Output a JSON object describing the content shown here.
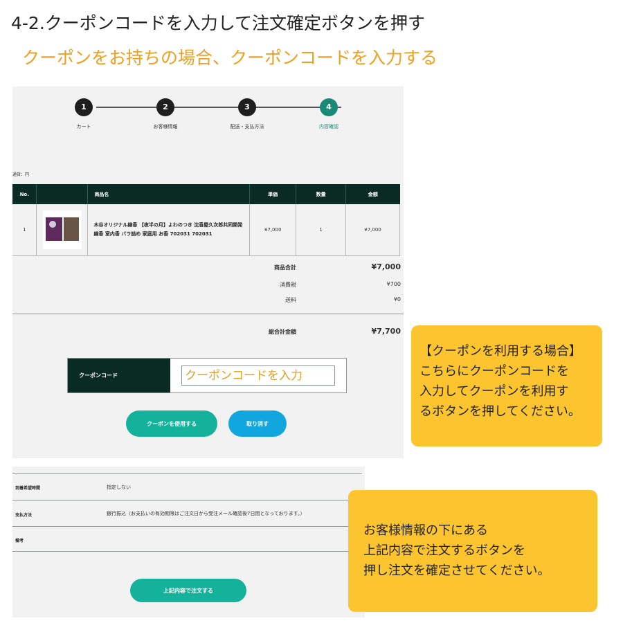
{
  "header": {
    "title": "4-2.クーポンコードを入力して注文確定ボタンを押す",
    "subtitle": "クーポンをお持ちの場合、クーポンコードを入力する"
  },
  "steps": [
    {
      "number": "1",
      "label": "カート"
    },
    {
      "number": "2",
      "label": "お客様情報"
    },
    {
      "number": "3",
      "label": "配送・支払方法"
    },
    {
      "number": "4",
      "label": "内容確認",
      "active": true
    }
  ],
  "currency_note": "通貨：円",
  "table": {
    "headers": [
      "No.",
      "",
      "商品名",
      "単価",
      "数量",
      "金額"
    ],
    "rows": [
      {
        "no": "1",
        "name": "木谷オリジナル線香 【夜半の月】よわのつき 沈香屋久次郎共同開発 線香 室内香 バラ詰め 家庭用 お香 702031 702031",
        "unit_price": "¥7,000",
        "quantity": "1",
        "amount": "¥7,000"
      }
    ]
  },
  "summary": {
    "subtotal_label": "商品合計",
    "subtotal": "¥7,000",
    "tax_label": "消費税",
    "tax": "¥700",
    "shipping_label": "送料",
    "shipping": "¥0",
    "total_label": "総合計金額",
    "total": "¥7,700"
  },
  "coupon": {
    "label": "クーポンコード",
    "placeholder": "クーポンコードを入力",
    "use_button": "クーポンを使用する",
    "cancel_button": "取り消す"
  },
  "details": [
    {
      "label": "到着希望時間",
      "value": "指定しない"
    },
    {
      "label": "支払方法",
      "value": "銀行振込（お支払いの有効期限はご注文日から受注メール確認後7日間となっております。）"
    },
    {
      "label": "備考",
      "value": ""
    }
  ],
  "order_button": "上記内容で注文する",
  "callouts": {
    "coupon": [
      "【クーポンを利用する場合】",
      "こちらにクーポンコードを",
      "入力してクーポンを利用す",
      "るボタンを押してください。"
    ],
    "order": [
      "お客様情報の下にある",
      "上記内容で注文するボタンを",
      "押し注文を確定させてください。"
    ]
  },
  "colors": {
    "dark_green": "#0a2a24",
    "teal": "#14b29a",
    "blue": "#12a6df",
    "callout_yellow": "#fcc52f",
    "subtitle_orange": "#f0a020"
  }
}
